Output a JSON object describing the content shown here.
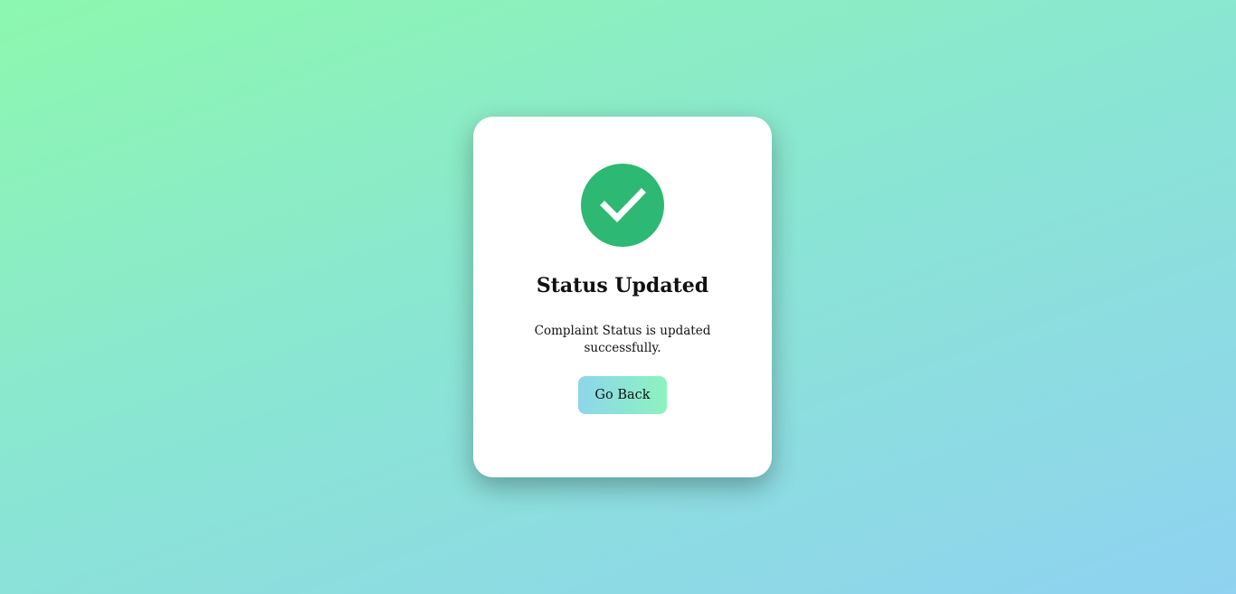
{
  "dialog": {
    "icon": "check-circle-icon",
    "icon_color": "#2db874",
    "title": "Status Updated",
    "message": "Complaint Status is updated successfully.",
    "button_label": "Go Back"
  },
  "colors": {
    "background_start": "#8cf8ae",
    "background_end": "#8fd2f1",
    "button_gradient_start": "#8dd6ec",
    "button_gradient_end": "#8cf3bf"
  }
}
